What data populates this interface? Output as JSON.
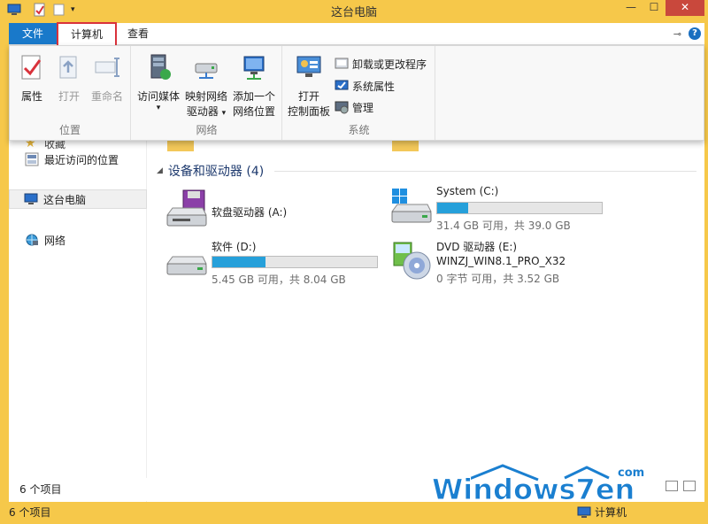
{
  "window": {
    "title": "这台电脑"
  },
  "title_buttons": {
    "minimize": "—",
    "maximize": "☐",
    "close": "✕"
  },
  "tabs": {
    "file": "文件",
    "computer": "计算机",
    "view": "查看"
  },
  "ribbon": {
    "location_group": {
      "label": "位置",
      "properties": "属性",
      "open": "打开",
      "rename": "重命名"
    },
    "network_group": {
      "label": "网络",
      "access_media": "访问媒体",
      "map_drive_line1": "映射网络",
      "map_drive_line2": "驱动器",
      "add_location_line1": "添加一个",
      "add_location_line2": "网络位置"
    },
    "system_group": {
      "label": "系统",
      "open_cp_line1": "打开",
      "open_cp_line2": "控制面板",
      "uninstall": "卸载或更改程序",
      "system_props": "系统属性",
      "manage": "管理"
    }
  },
  "nav": {
    "partial_top": "收藏",
    "recent": "最近访问的位置",
    "this_pc": "这台电脑",
    "network": "网络"
  },
  "content": {
    "section_title": "设备和驱动器 (4)",
    "drives": [
      {
        "name": "软盘驱动器 (A:)"
      },
      {
        "name": "System (C:)",
        "usage": 0.19,
        "info": "31.4 GB 可用，共 39.0 GB"
      },
      {
        "name": "软件 (D:)",
        "usage": 0.32,
        "info": "5.45 GB 可用，共 8.04 GB"
      },
      {
        "name": "DVD 驱动器 (E:)",
        "name2": "WINZJ_WIN8.1_PRO_X32",
        "info": "0 字节 可用，共 3.52 GB"
      }
    ]
  },
  "status": {
    "inner_count": "6 个项目",
    "count": "6 个项目",
    "right_label": "计算机"
  },
  "watermark": {
    "text": "Windows7en",
    "sub": "com"
  }
}
